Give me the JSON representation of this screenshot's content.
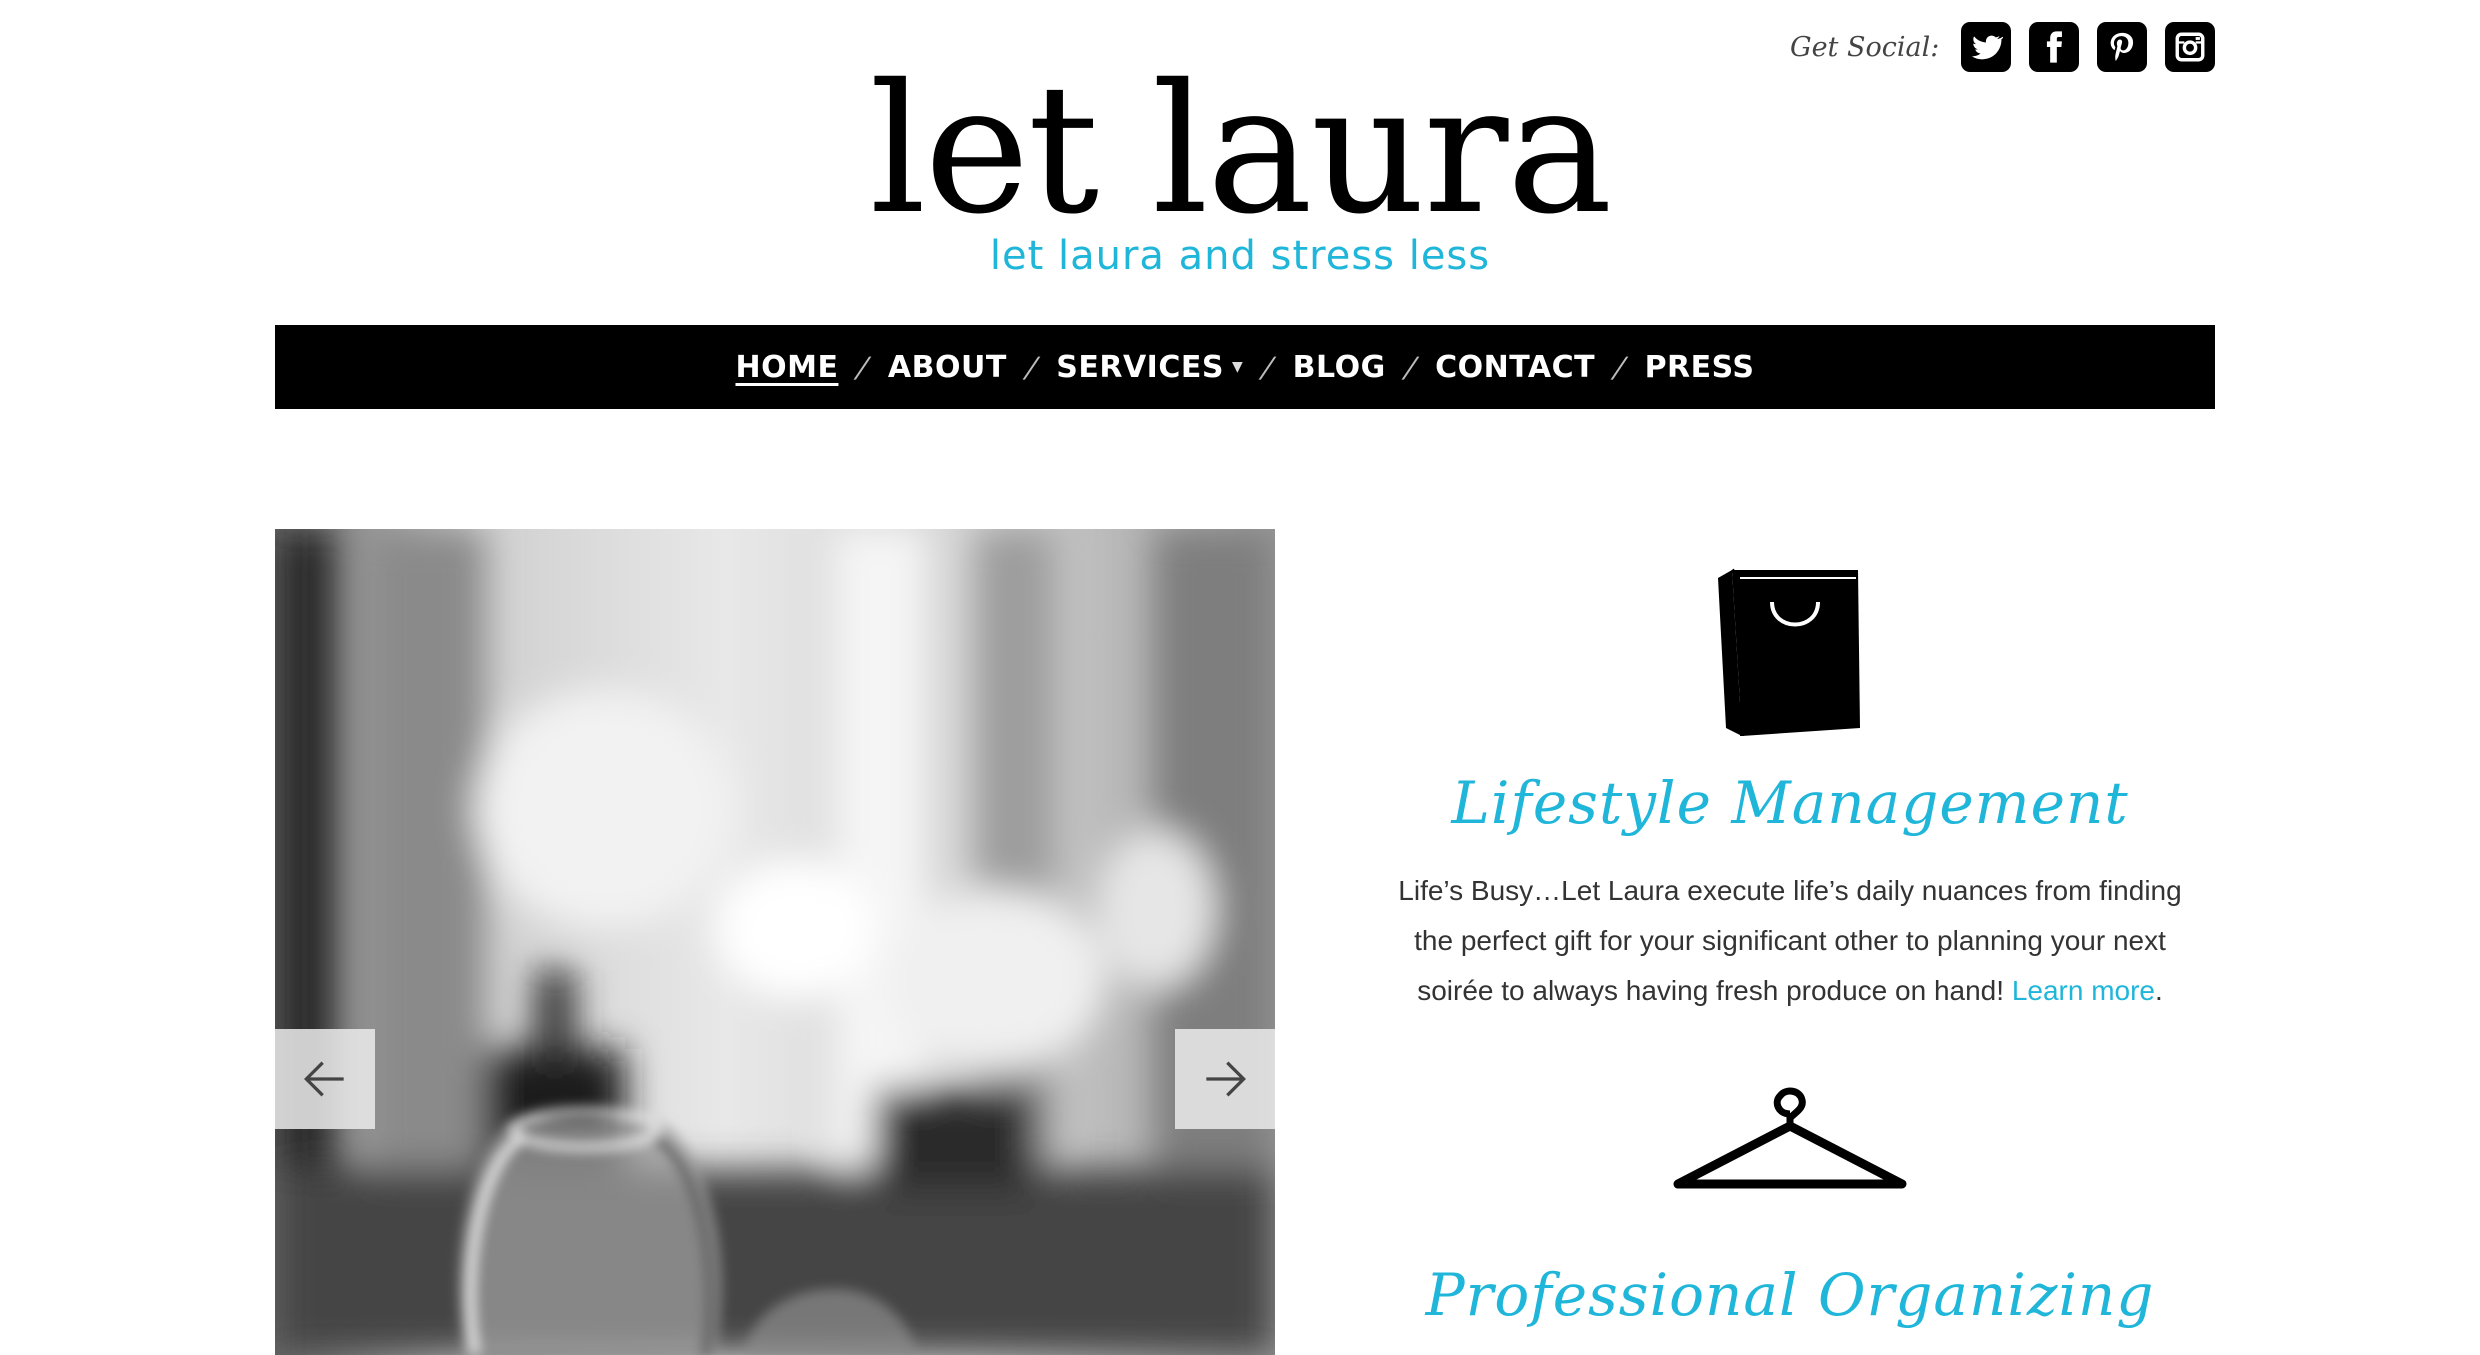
{
  "social": {
    "label": "Get Social:",
    "icons": [
      "twitter-icon",
      "facebook-icon",
      "pinterest-icon",
      "instagram-icon"
    ]
  },
  "logo": {
    "title": "let laura",
    "tagline": "let laura and stress less"
  },
  "nav": {
    "items": [
      {
        "label": "HOME",
        "active": true
      },
      {
        "label": "ABOUT"
      },
      {
        "label": "SERVICES",
        "has_dropdown": true
      },
      {
        "label": "BLOG"
      },
      {
        "label": "CONTACT"
      },
      {
        "label": "PRESS"
      }
    ]
  },
  "slider": {
    "prev_icon": "arrow-left-icon",
    "next_icon": "arrow-right-icon"
  },
  "services": [
    {
      "icon": "shopping-bag-icon",
      "title": "Lifestyle Management",
      "description": "Life’s Busy…Let Laura execute life’s daily nuances from finding the perfect gift for your significant other to planning your next soirée to always having fresh produce on hand!",
      "link_text": "Learn more",
      "after_link": "."
    },
    {
      "icon": "hanger-icon",
      "title": "Professional Organizing"
    }
  ],
  "colors": {
    "accent": "#1fb6d9",
    "nav_bg": "#000000",
    "text": "#333333"
  }
}
